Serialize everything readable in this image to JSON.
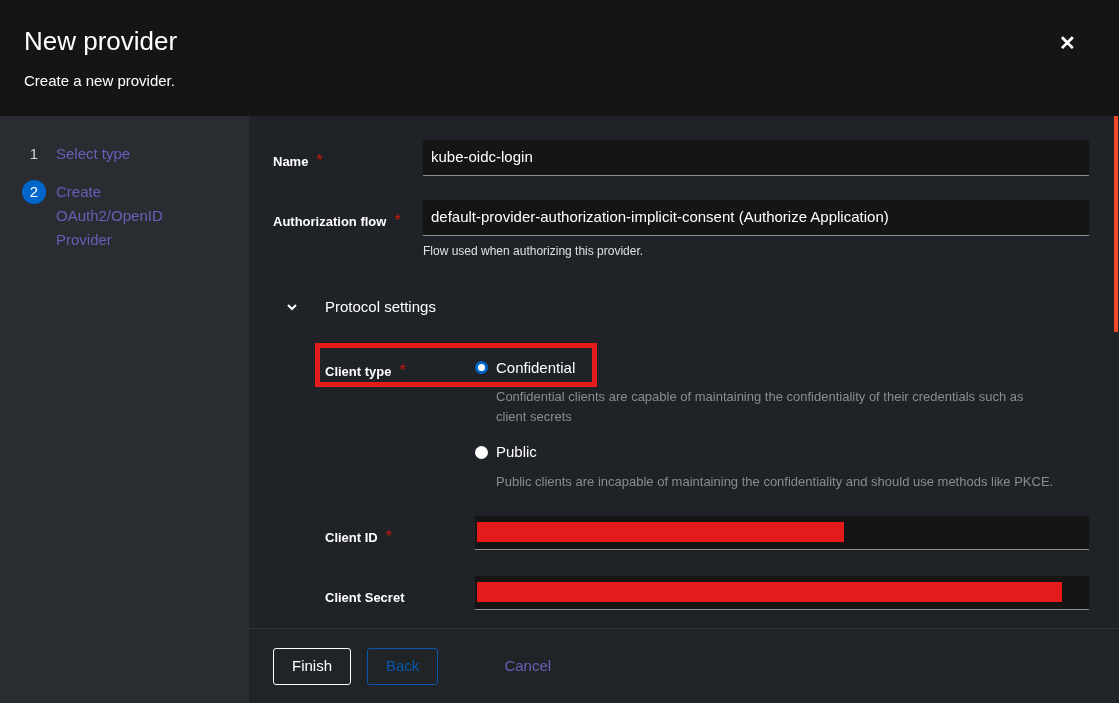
{
  "header": {
    "title": "New provider",
    "subtitle": "Create a new provider.",
    "close": "✕"
  },
  "steps": [
    {
      "number": "1",
      "label": "Select type",
      "selected": false
    },
    {
      "number": "2",
      "label": "Create OAuth2/OpenID Provider",
      "selected": true
    }
  ],
  "fields": [
    {
      "label": "Name",
      "required_mark": "*",
      "value": "kube-oidc-login"
    },
    {
      "label": "Authorization flow",
      "required_mark": "*",
      "value": "default-provider-authorization-implicit-consent (Authorize Application)",
      "helper": "Flow used when authorizing this provider."
    }
  ],
  "protocol_settings": {
    "title": "Protocol settings",
    "expanded": true,
    "client_type": {
      "label": "Client type",
      "required_mark": "*",
      "options": [
        {
          "label": "Confidential",
          "selected": true,
          "description": "Confidential clients are capable of maintaining the confidentiality of their credentials such as client secrets"
        },
        {
          "label": "Public",
          "selected": false,
          "description": "Public clients are incapable of maintaining the confidentiality and should use methods like PKCE."
        }
      ]
    },
    "secret_fields": [
      {
        "label": "Client ID",
        "required_mark": "*"
      },
      {
        "label": "Client Secret"
      }
    ]
  },
  "buttons": [
    {
      "label": "Finish",
      "kind": "primary",
      "disabled": false
    },
    {
      "label": "Back",
      "kind": "secondary",
      "disabled": true
    },
    {
      "label": "Cancel",
      "kind": "link",
      "disabled": false
    }
  ]
}
